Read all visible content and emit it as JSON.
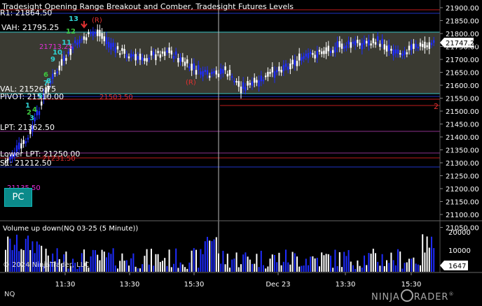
{
  "chart": {
    "title": "Tradesight Opening Range Breakout and Comber, Tradesight Futures Levels",
    "instrument_footer": "NQ",
    "pc_button": "PC",
    "price_axis": {
      "ticks": [
        "21900.00",
        "21850.00",
        "21800.00",
        "21750.00",
        "21700.00",
        "21650.00",
        "21600.00",
        "21550.00",
        "21500.00",
        "21450.00",
        "21400.00",
        "21350.00",
        "21300.00",
        "21250.00",
        "21200.00",
        "21150.00",
        "21100.00",
        "21050.00"
      ],
      "last_price": "21747.25"
    },
    "levels": {
      "r1": "R1: 21864.50",
      "vah": "VAH: 21795.25",
      "val": "VAL: 21526.75",
      "pivot": "PIVOT: 21510.00",
      "lpt": "LPT: 21362.50",
      "low_lpt": "Lower LPT: 21250.00",
      "s1": "S1: 21212.50",
      "label_21503": "21503.50",
      "label_21231": "21231.50",
      "label_21135": "21135.50",
      "label_21713": "21713.25",
      "marker_2": "2",
      "marker_r": "(R)",
      "marker_r2": "(R)"
    },
    "counters": [
      "1",
      "2",
      "3",
      "4",
      "5",
      "6",
      "7",
      "8",
      "9",
      "10",
      "11",
      "12",
      "13"
    ],
    "volume_panel": {
      "title": "Volume up down(NQ 03-25 (5 Minute))",
      "ticks": [
        "20000",
        "10000"
      ],
      "last_volume": "1647"
    },
    "time_axis": [
      "11:30",
      "13:30",
      "15:30",
      "Dec 23",
      "13:30",
      "15:30"
    ],
    "copyright": "© 2024 NinjaTrader, LLC",
    "brand": "NINJATRADER"
  },
  "colors": {
    "background": "#000000",
    "value_area_fill": "#3a3a32",
    "up_bar": "#ffffff",
    "down_bar": "#1e2cff",
    "resistance": "#c01c1c",
    "support_blue": "#1f35c8",
    "cyan": "#39c6c6",
    "pink": "#e22fd9",
    "purple": "#8c2f8c",
    "counter_green": "#3ec63e",
    "counter_cyan": "#2fd3d3"
  }
}
